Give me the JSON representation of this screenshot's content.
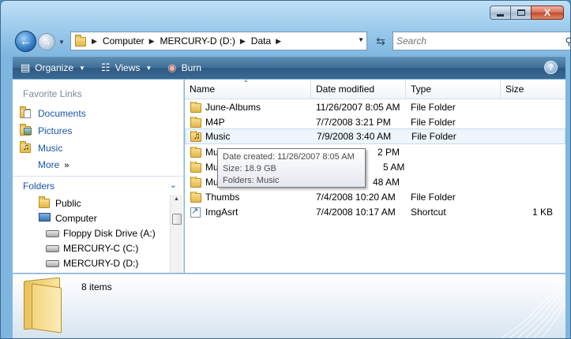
{
  "window": {
    "caption": {
      "minimize": "",
      "maximize": "",
      "close": "X"
    }
  },
  "address_bar": {
    "crumbs": [
      "Computer",
      "MERCURY-D (D:)",
      "Data"
    ]
  },
  "search": {
    "placeholder": "Search"
  },
  "toolbar": {
    "organize_label": "Organize",
    "views_label": "Views",
    "burn_label": "Burn",
    "help_label": "?"
  },
  "nav_pane": {
    "favorites_title": "Favorite Links",
    "favorites": [
      {
        "label": "Documents",
        "icon": "documents-icon"
      },
      {
        "label": "Pictures",
        "icon": "pictures-icon"
      },
      {
        "label": "Music",
        "icon": "music-icon"
      }
    ],
    "more_label": "More",
    "folders_label": "Folders",
    "tree": [
      {
        "label": "Public",
        "icon": "folder-icon"
      },
      {
        "label": "Computer",
        "icon": "computer-icon"
      },
      {
        "label": "Floppy Disk Drive (A:)",
        "icon": "floppy-drive-icon"
      },
      {
        "label": "MERCURY-C (C:)",
        "icon": "hard-drive-icon"
      },
      {
        "label": "MERCURY-D (D:)",
        "icon": "hard-drive-icon"
      }
    ]
  },
  "file_list": {
    "columns": [
      "Name",
      "Date modified",
      "Type",
      "Size"
    ],
    "rows": [
      {
        "name": "June-Albums",
        "date": "11/26/2007 8:05 AM",
        "type": "File Folder",
        "size": "",
        "icon": "folder-icon"
      },
      {
        "name": "M4P",
        "date": "7/7/2008 3:21 PM",
        "type": "File Folder",
        "size": "",
        "icon": "folder-icon"
      },
      {
        "name": "Music",
        "date": "7/9/2008 3:40 AM",
        "type": "File Folder",
        "size": "",
        "icon": "music-folder-icon"
      },
      {
        "name": "Mu",
        "date": "2 PM",
        "type": "",
        "size": "",
        "icon": "folder-icon"
      },
      {
        "name": "Mu",
        "date": "5 AM",
        "type": "",
        "size": "",
        "icon": "folder-icon"
      },
      {
        "name": "Mu",
        "date": "48 AM",
        "type": "",
        "size": "",
        "icon": "folder-icon"
      },
      {
        "name": "Thumbs",
        "date": "7/4/2008 10:20 AM",
        "type": "File Folder",
        "size": "",
        "icon": "folder-icon"
      },
      {
        "name": "ImgAsrt",
        "date": "7/4/2008 10:17 AM",
        "type": "Shortcut",
        "size": "1 KB",
        "icon": "shortcut-icon"
      }
    ]
  },
  "tooltip": {
    "line1": "Date created: 11/26/2007 8:05 AM",
    "line2": "Size: 18.9 GB",
    "line3": "Folders: Music"
  },
  "details": {
    "item_count": "8 items"
  }
}
